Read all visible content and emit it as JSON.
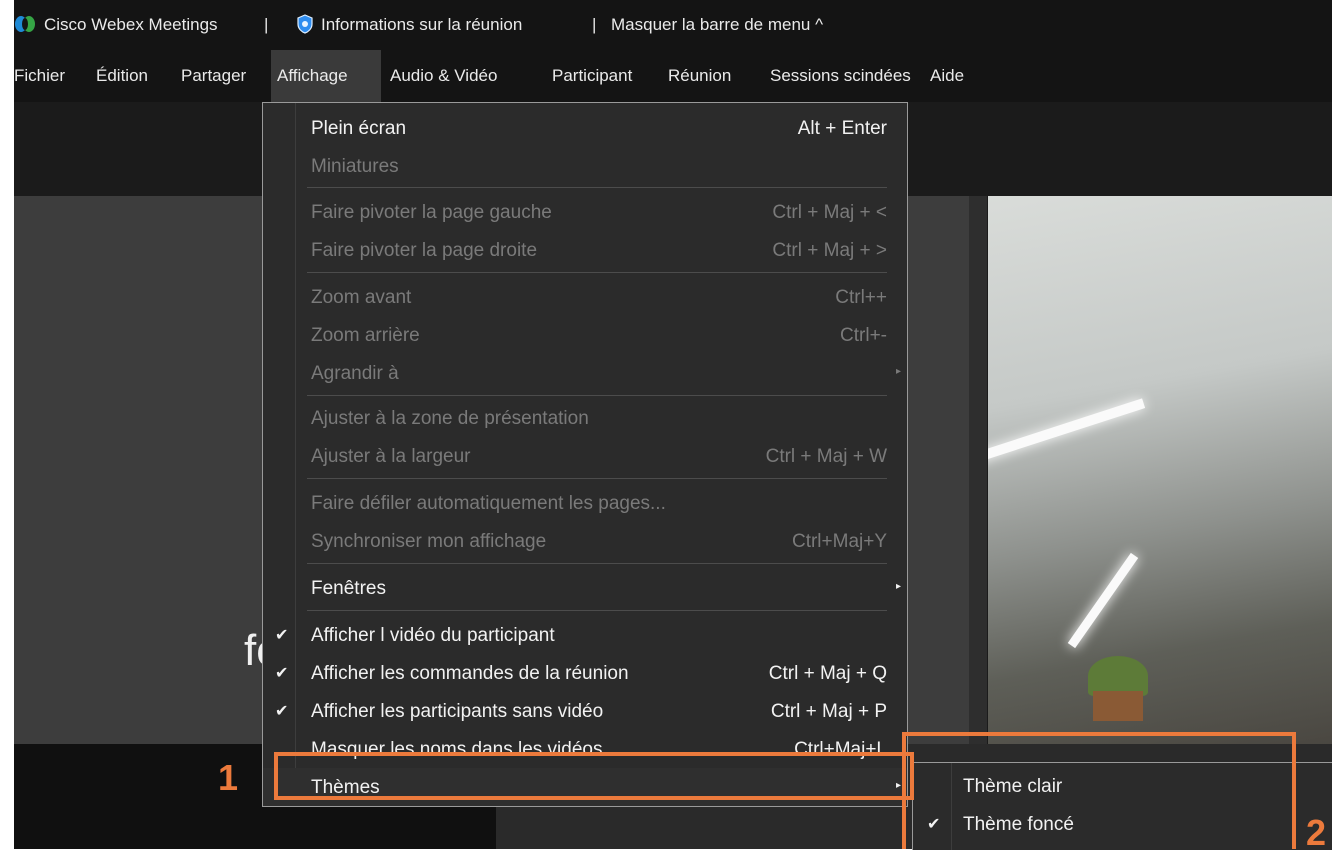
{
  "titlebar": {
    "app_name": "Cisco Webex Meetings",
    "sep1": "|",
    "meeting_info": "Informations sur la réunion",
    "sep2": "|",
    "hide_menu": "Masquer la barre de menu ^"
  },
  "menubar": {
    "items": [
      {
        "label": "Fichier"
      },
      {
        "label": "Édition"
      },
      {
        "label": "Partager"
      },
      {
        "label": "Affichage"
      },
      {
        "label": "Audio & Vidéo"
      },
      {
        "label": "Participant"
      },
      {
        "label": "Réunion"
      },
      {
        "label": "Sessions scindées"
      },
      {
        "label": "Aide"
      }
    ]
  },
  "slide": {
    "text": "fo"
  },
  "view_menu": {
    "items": [
      {
        "label": "Plein écran",
        "shortcut": "Alt + Enter",
        "enabled": true
      },
      {
        "label": "Miniatures",
        "shortcut": "",
        "enabled": false
      },
      {
        "label": "Faire pivoter la page gauche",
        "shortcut": "Ctrl + Maj + <",
        "enabled": false
      },
      {
        "label": "Faire pivoter la page droite",
        "shortcut": "Ctrl + Maj + >",
        "enabled": false
      },
      {
        "label": "Zoom avant",
        "shortcut": "Ctrl++",
        "enabled": false
      },
      {
        "label": "Zoom arrière",
        "shortcut": "Ctrl+-",
        "enabled": false
      },
      {
        "label": "Agrandir à",
        "shortcut": "",
        "enabled": false
      },
      {
        "label": "Ajuster à la zone de présentation",
        "shortcut": "",
        "enabled": false
      },
      {
        "label": "Ajuster à la largeur",
        "shortcut": "Ctrl + Maj + W",
        "enabled": false
      },
      {
        "label": "Faire défiler automatiquement les pages...",
        "shortcut": "",
        "enabled": false
      },
      {
        "label": "Synchroniser mon affichage",
        "shortcut": "Ctrl+Maj+Y",
        "enabled": false
      },
      {
        "label": "Fenêtres",
        "shortcut": "",
        "enabled": true
      },
      {
        "label": "Afficher l vidéo du participant",
        "shortcut": "",
        "enabled": true,
        "checked": true
      },
      {
        "label": "Afficher les commandes de la réunion",
        "shortcut": "Ctrl + Maj + Q",
        "enabled": true,
        "checked": true
      },
      {
        "label": "Afficher les participants sans vidéo",
        "shortcut": "Ctrl + Maj + P",
        "enabled": true,
        "checked": true
      },
      {
        "label": "Masquer les noms dans les vidéos",
        "shortcut": "Ctrl+Maj+L",
        "enabled": true
      },
      {
        "label": "Thèmes",
        "shortcut": "",
        "enabled": true
      }
    ]
  },
  "themes_submenu": {
    "items": [
      {
        "label": "Thème clair",
        "checked": false
      },
      {
        "label": "Thème foncé",
        "checked": true
      }
    ]
  },
  "annotations": {
    "step1": "1",
    "step2": "2",
    "color": "#ec7a3c"
  },
  "icons": {
    "check": "✔",
    "arrow": "▸",
    "logo": "webex-logo-icon",
    "shield": "shield-icon"
  }
}
